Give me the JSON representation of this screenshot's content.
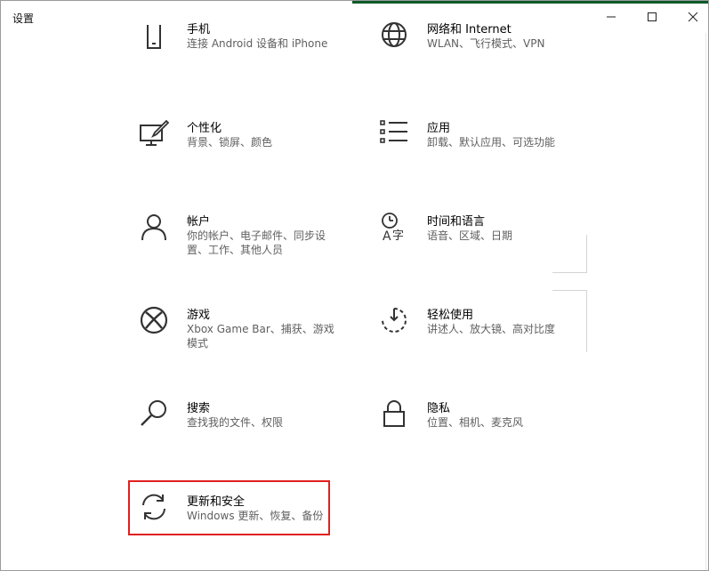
{
  "window": {
    "title": "设置"
  },
  "tiles": [
    {
      "id": "phone",
      "label": "手机",
      "desc": "连接 Android 设备和 iPhone",
      "icon": "phone-icon"
    },
    {
      "id": "network",
      "label": "网络和 Internet",
      "desc": "WLAN、飞行模式、VPN",
      "icon": "globe-icon"
    },
    {
      "id": "personalization",
      "label": "个性化",
      "desc": "背景、锁屏、颜色",
      "icon": "personalization-icon"
    },
    {
      "id": "apps",
      "label": "应用",
      "desc": "卸载、默认应用、可选功能",
      "icon": "apps-list-icon"
    },
    {
      "id": "accounts",
      "label": "帐户",
      "desc": "你的帐户、电子邮件、同步设置、工作、其他人员",
      "icon": "person-icon"
    },
    {
      "id": "time-language",
      "label": "时间和语言",
      "desc": "语音、区域、日期",
      "icon": "time-language-icon"
    },
    {
      "id": "gaming",
      "label": "游戏",
      "desc": "Xbox Game Bar、捕获、游戏模式",
      "icon": "xbox-icon"
    },
    {
      "id": "ease-of-access",
      "label": "轻松使用",
      "desc": "讲述人、放大镜、高对比度",
      "icon": "ease-of-access-icon"
    },
    {
      "id": "search",
      "label": "搜索",
      "desc": "查找我的文件、权限",
      "icon": "search-icon"
    },
    {
      "id": "privacy",
      "label": "隐私",
      "desc": "位置、相机、麦克风",
      "icon": "lock-icon"
    },
    {
      "id": "update-security",
      "label": "更新和安全",
      "desc": "Windows 更新、恢复、备份",
      "icon": "sync-icon"
    }
  ],
  "colors": {
    "highlight_border": "#e02020",
    "accent_strip": "#0a5a2a",
    "desc_text": "#5f5f5f"
  }
}
